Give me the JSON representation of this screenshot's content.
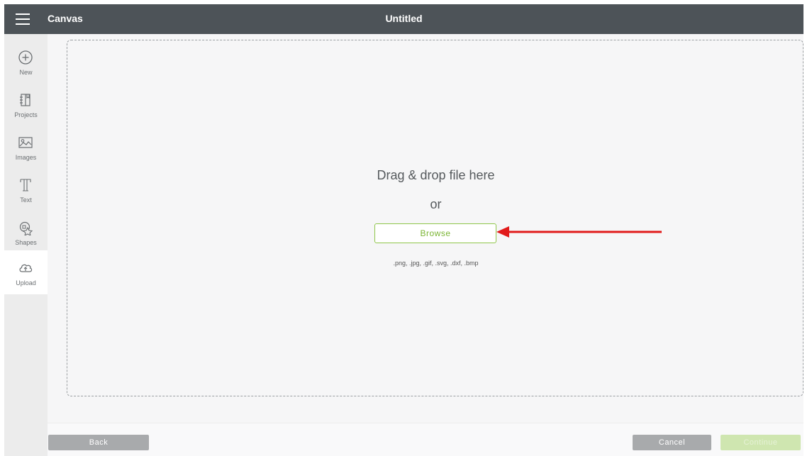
{
  "topbar": {
    "app_title": "Canvas",
    "doc_title": "Untitled",
    "bg_color": "#4d5358"
  },
  "sidebar": {
    "items": [
      {
        "label": "New",
        "icon": "plus-circle-icon"
      },
      {
        "label": "Projects",
        "icon": "projects-icon"
      },
      {
        "label": "Images",
        "icon": "image-icon"
      },
      {
        "label": "Text",
        "icon": "text-icon"
      },
      {
        "label": "Shapes",
        "icon": "shapes-icon"
      },
      {
        "label": "Upload",
        "icon": "cloud-upload-icon",
        "active": true
      }
    ]
  },
  "upload": {
    "drag_text": "Drag & drop file here",
    "or_text": "or",
    "browse_label": "Browse",
    "formats": ".png, .jpg, .gif, .svg, .dxf, .bmp",
    "accent_color": "#7bb534",
    "annotation": "red-arrow-icon"
  },
  "footer": {
    "back_label": "Back",
    "cancel_label": "Cancel",
    "continue_label": "Continue"
  }
}
